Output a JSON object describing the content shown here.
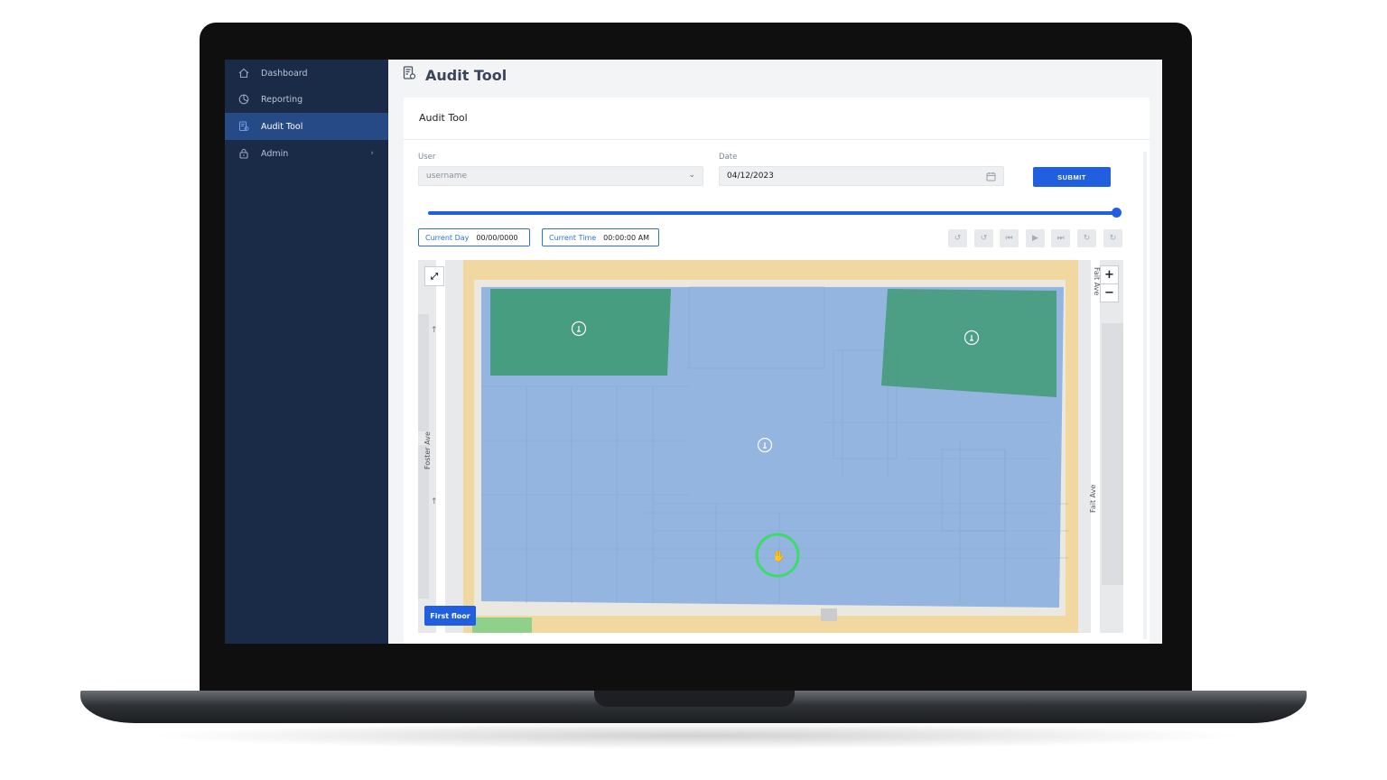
{
  "sidebar": {
    "items": [
      {
        "label": "Dashboard",
        "icon": "home-icon"
      },
      {
        "label": "Reporting",
        "icon": "chart-pie-icon"
      },
      {
        "label": "Audit Tool",
        "icon": "audit-icon",
        "active": true
      },
      {
        "label": "Admin",
        "icon": "lock-icon",
        "has_submenu": true
      }
    ]
  },
  "header": {
    "title": "Audit Tool"
  },
  "card": {
    "title": "Audit Tool",
    "user": {
      "label": "User",
      "placeholder": "username"
    },
    "date": {
      "label": "Date",
      "value": "04/12/2023"
    },
    "submit_label": "SUBMIT"
  },
  "timeline": {
    "progress_fraction": 1.0
  },
  "status": {
    "current_day_label": "Current Day",
    "current_day_value": "00/00/0000",
    "current_time_label": "Current Time",
    "current_time_value": "00:00:00 AM"
  },
  "playback_controls": [
    "rewind-15-icon",
    "rewind-5-icon",
    "skip-back-icon",
    "play-icon",
    "skip-forward-icon",
    "forward-5-icon",
    "forward-15-icon"
  ],
  "map": {
    "streets": {
      "west": "Foster Ave",
      "east": "Fait Ave",
      "north_east": "Fait Ave"
    },
    "zoom_in": "+",
    "zoom_out": "−",
    "floor_button": "First floor",
    "colors": {
      "zone_blue": "#7aa7e0",
      "zone_green": "#3f9a74",
      "building_outline": "#f1d8a0",
      "cursor_ring": "#3ddc6a"
    }
  }
}
